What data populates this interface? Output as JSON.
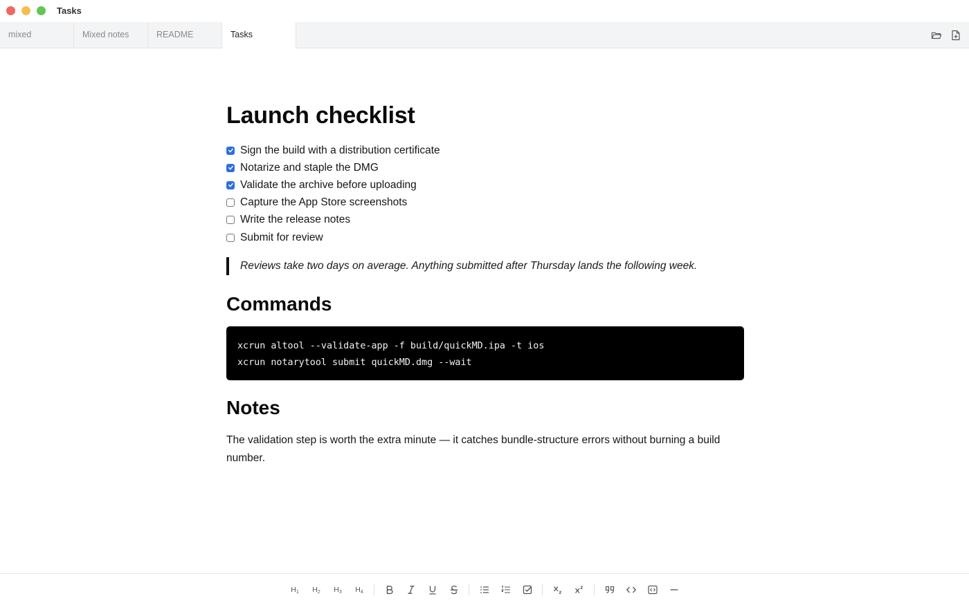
{
  "window": {
    "title": "Tasks"
  },
  "tabs": [
    {
      "label": "mixed",
      "active": false
    },
    {
      "label": "Mixed notes",
      "active": false
    },
    {
      "label": "README",
      "active": false
    },
    {
      "label": "Tasks",
      "active": true
    }
  ],
  "tab_actions": [
    {
      "icon": "folder-open-icon"
    },
    {
      "icon": "new-document-icon"
    }
  ],
  "document": {
    "title": "Launch checklist",
    "tasks": [
      {
        "text": "Sign the build with a distribution certificate",
        "done": true
      },
      {
        "text": "Notarize and staple the DMG",
        "done": true
      },
      {
        "text": "Validate the archive before uploading",
        "done": true
      },
      {
        "text": "Capture the App Store screenshots",
        "done": false
      },
      {
        "text": "Write the release notes",
        "done": false
      },
      {
        "text": "Submit for review",
        "done": false
      }
    ],
    "quote": "Reviews take two days on average. Anything submitted after Thursday lands the following week.",
    "commands_heading": "Commands",
    "code_lines": [
      "xcrun altool --validate-app -f build/quickMD.ipa -t ios",
      "xcrun notarytool submit quickMD.dmg --wait"
    ],
    "notes_heading": "Notes",
    "notes_text": "The validation step is worth the extra minute — it catches bundle-structure errors without burning a build number."
  },
  "toolbar": {
    "headings": [
      {
        "label": "H",
        "sub": "1"
      },
      {
        "label": "H",
        "sub": "2"
      },
      {
        "label": "H",
        "sub": "3"
      },
      {
        "label": "H",
        "sub": "4"
      }
    ],
    "icons": [
      "bold-icon",
      "italic-icon",
      "underline-icon",
      "strikethrough-icon",
      "bulleted-list-icon",
      "numbered-list-icon",
      "task-list-icon",
      "subscript-icon",
      "superscript-icon",
      "quote-icon",
      "inline-code-icon",
      "code-block-icon",
      "horizontal-rule-icon"
    ]
  },
  "colors": {
    "checkbox_checked": "#2f6fdf",
    "close": "#ee6a5f",
    "minimize": "#f5be4f",
    "maximize": "#62c554",
    "code_background": "#000000"
  }
}
